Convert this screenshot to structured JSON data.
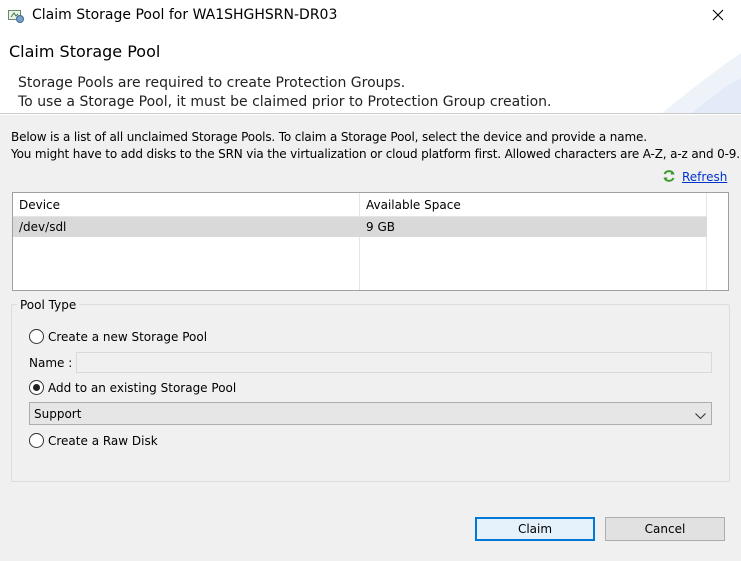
{
  "window": {
    "title": "Claim Storage Pool for WA1SHGHSRN-DR03",
    "icon": "storage-app-icon",
    "close_icon": "close-icon"
  },
  "header": {
    "title": "Claim Storage Pool",
    "description_line1": "Storage Pools are required to create Protection Groups.",
    "description_line2": "To use a Storage Pool, it must be claimed prior to Protection Group creation."
  },
  "instructions": {
    "line1": "Below is a list of all unclaimed Storage Pools. To claim a Storage Pool, select the device and provide a name.",
    "line2": "You might have to add disks to the SRN via the virtualization or cloud platform first. Allowed characters are A-Z, a-z and 0-9."
  },
  "refresh": {
    "label": "Refresh",
    "icon": "refresh-icon"
  },
  "grid": {
    "columns": [
      "Device",
      "Available Space"
    ],
    "rows": [
      {
        "device": "/dev/sdl",
        "available_space": "9 GB",
        "selected": true
      }
    ]
  },
  "pool_type": {
    "label": "Pool Type",
    "options": [
      {
        "label": "Create a new Storage Pool",
        "checked": false
      },
      {
        "label": "Add to an existing Storage Pool",
        "checked": true
      },
      {
        "label": "Create a Raw Disk",
        "checked": false
      }
    ],
    "name_label": "Name :",
    "name_value": "",
    "existing_pool": "Support"
  },
  "buttons": {
    "claim": "Claim",
    "cancel": "Cancel"
  },
  "colors": {
    "link": "#0033cc",
    "selected_row": "#d9d9d9",
    "primary_border": "#0078d7"
  }
}
